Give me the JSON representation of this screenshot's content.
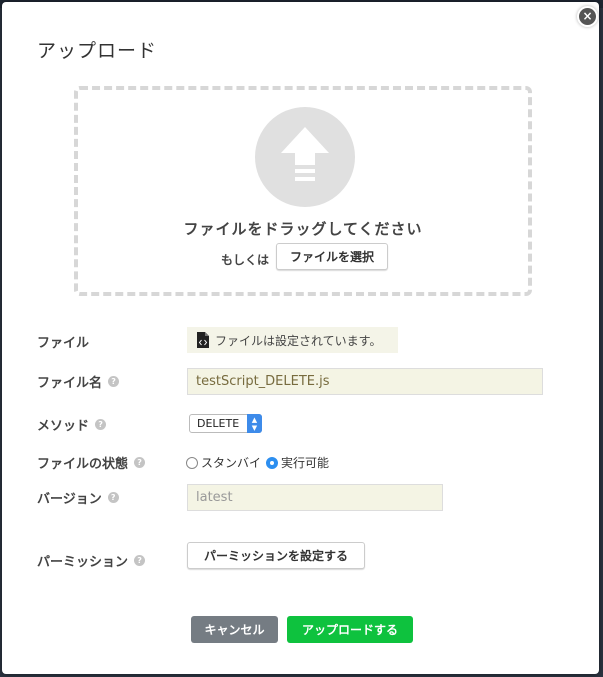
{
  "dialog": {
    "title": "アップロード",
    "close_glyph": "×"
  },
  "dropzone": {
    "drag_text": "ファイルをドラッグしてください",
    "or_text": "もしくは",
    "select_file_label": "ファイルを選択",
    "icon": "upload-arrow-icon"
  },
  "form": {
    "file": {
      "label": "ファイル",
      "status_text": "ファイルは設定されています。",
      "icon": "script-file-icon"
    },
    "filename": {
      "label": "ファイル名",
      "value": "testScript_DELETE.js"
    },
    "method": {
      "label": "メソッド",
      "selected": "DELETE"
    },
    "file_state": {
      "label": "ファイルの状態",
      "options": [
        {
          "label": "スタンバイ",
          "checked": false
        },
        {
          "label": "実行可能",
          "checked": true
        }
      ]
    },
    "version": {
      "label": "バージョン",
      "placeholder": "latest"
    },
    "permission": {
      "label": "パーミッション",
      "button_label": "パーミッションを設定する"
    },
    "help_glyph": "?"
  },
  "footer": {
    "cancel_label": "キャンセル",
    "upload_label": "アップロードする"
  },
  "colors": {
    "upload_button": "#0ec23e",
    "cancel_button": "#757c83",
    "radio_checked": "#2d8ff0",
    "select_arrow": "#3d8bea"
  }
}
